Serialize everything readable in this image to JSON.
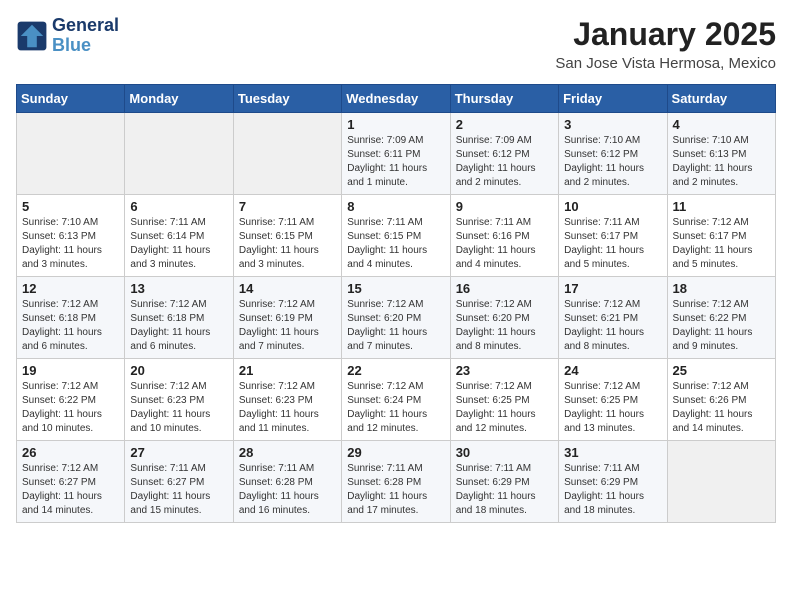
{
  "logo": {
    "line1": "General",
    "line2": "Blue"
  },
  "title": "January 2025",
  "location": "San Jose Vista Hermosa, Mexico",
  "days_of_week": [
    "Sunday",
    "Monday",
    "Tuesday",
    "Wednesday",
    "Thursday",
    "Friday",
    "Saturday"
  ],
  "weeks": [
    [
      {
        "day": "",
        "info": ""
      },
      {
        "day": "",
        "info": ""
      },
      {
        "day": "",
        "info": ""
      },
      {
        "day": "1",
        "info": "Sunrise: 7:09 AM\nSunset: 6:11 PM\nDaylight: 11 hours\nand 1 minute."
      },
      {
        "day": "2",
        "info": "Sunrise: 7:09 AM\nSunset: 6:12 PM\nDaylight: 11 hours\nand 2 minutes."
      },
      {
        "day": "3",
        "info": "Sunrise: 7:10 AM\nSunset: 6:12 PM\nDaylight: 11 hours\nand 2 minutes."
      },
      {
        "day": "4",
        "info": "Sunrise: 7:10 AM\nSunset: 6:13 PM\nDaylight: 11 hours\nand 2 minutes."
      }
    ],
    [
      {
        "day": "5",
        "info": "Sunrise: 7:10 AM\nSunset: 6:13 PM\nDaylight: 11 hours\nand 3 minutes."
      },
      {
        "day": "6",
        "info": "Sunrise: 7:11 AM\nSunset: 6:14 PM\nDaylight: 11 hours\nand 3 minutes."
      },
      {
        "day": "7",
        "info": "Sunrise: 7:11 AM\nSunset: 6:15 PM\nDaylight: 11 hours\nand 3 minutes."
      },
      {
        "day": "8",
        "info": "Sunrise: 7:11 AM\nSunset: 6:15 PM\nDaylight: 11 hours\nand 4 minutes."
      },
      {
        "day": "9",
        "info": "Sunrise: 7:11 AM\nSunset: 6:16 PM\nDaylight: 11 hours\nand 4 minutes."
      },
      {
        "day": "10",
        "info": "Sunrise: 7:11 AM\nSunset: 6:17 PM\nDaylight: 11 hours\nand 5 minutes."
      },
      {
        "day": "11",
        "info": "Sunrise: 7:12 AM\nSunset: 6:17 PM\nDaylight: 11 hours\nand 5 minutes."
      }
    ],
    [
      {
        "day": "12",
        "info": "Sunrise: 7:12 AM\nSunset: 6:18 PM\nDaylight: 11 hours\nand 6 minutes."
      },
      {
        "day": "13",
        "info": "Sunrise: 7:12 AM\nSunset: 6:18 PM\nDaylight: 11 hours\nand 6 minutes."
      },
      {
        "day": "14",
        "info": "Sunrise: 7:12 AM\nSunset: 6:19 PM\nDaylight: 11 hours\nand 7 minutes."
      },
      {
        "day": "15",
        "info": "Sunrise: 7:12 AM\nSunset: 6:20 PM\nDaylight: 11 hours\nand 7 minutes."
      },
      {
        "day": "16",
        "info": "Sunrise: 7:12 AM\nSunset: 6:20 PM\nDaylight: 11 hours\nand 8 minutes."
      },
      {
        "day": "17",
        "info": "Sunrise: 7:12 AM\nSunset: 6:21 PM\nDaylight: 11 hours\nand 8 minutes."
      },
      {
        "day": "18",
        "info": "Sunrise: 7:12 AM\nSunset: 6:22 PM\nDaylight: 11 hours\nand 9 minutes."
      }
    ],
    [
      {
        "day": "19",
        "info": "Sunrise: 7:12 AM\nSunset: 6:22 PM\nDaylight: 11 hours\nand 10 minutes."
      },
      {
        "day": "20",
        "info": "Sunrise: 7:12 AM\nSunset: 6:23 PM\nDaylight: 11 hours\nand 10 minutes."
      },
      {
        "day": "21",
        "info": "Sunrise: 7:12 AM\nSunset: 6:23 PM\nDaylight: 11 hours\nand 11 minutes."
      },
      {
        "day": "22",
        "info": "Sunrise: 7:12 AM\nSunset: 6:24 PM\nDaylight: 11 hours\nand 12 minutes."
      },
      {
        "day": "23",
        "info": "Sunrise: 7:12 AM\nSunset: 6:25 PM\nDaylight: 11 hours\nand 12 minutes."
      },
      {
        "day": "24",
        "info": "Sunrise: 7:12 AM\nSunset: 6:25 PM\nDaylight: 11 hours\nand 13 minutes."
      },
      {
        "day": "25",
        "info": "Sunrise: 7:12 AM\nSunset: 6:26 PM\nDaylight: 11 hours\nand 14 minutes."
      }
    ],
    [
      {
        "day": "26",
        "info": "Sunrise: 7:12 AM\nSunset: 6:27 PM\nDaylight: 11 hours\nand 14 minutes."
      },
      {
        "day": "27",
        "info": "Sunrise: 7:11 AM\nSunset: 6:27 PM\nDaylight: 11 hours\nand 15 minutes."
      },
      {
        "day": "28",
        "info": "Sunrise: 7:11 AM\nSunset: 6:28 PM\nDaylight: 11 hours\nand 16 minutes."
      },
      {
        "day": "29",
        "info": "Sunrise: 7:11 AM\nSunset: 6:28 PM\nDaylight: 11 hours\nand 17 minutes."
      },
      {
        "day": "30",
        "info": "Sunrise: 7:11 AM\nSunset: 6:29 PM\nDaylight: 11 hours\nand 18 minutes."
      },
      {
        "day": "31",
        "info": "Sunrise: 7:11 AM\nSunset: 6:29 PM\nDaylight: 11 hours\nand 18 minutes."
      },
      {
        "day": "",
        "info": ""
      }
    ]
  ]
}
